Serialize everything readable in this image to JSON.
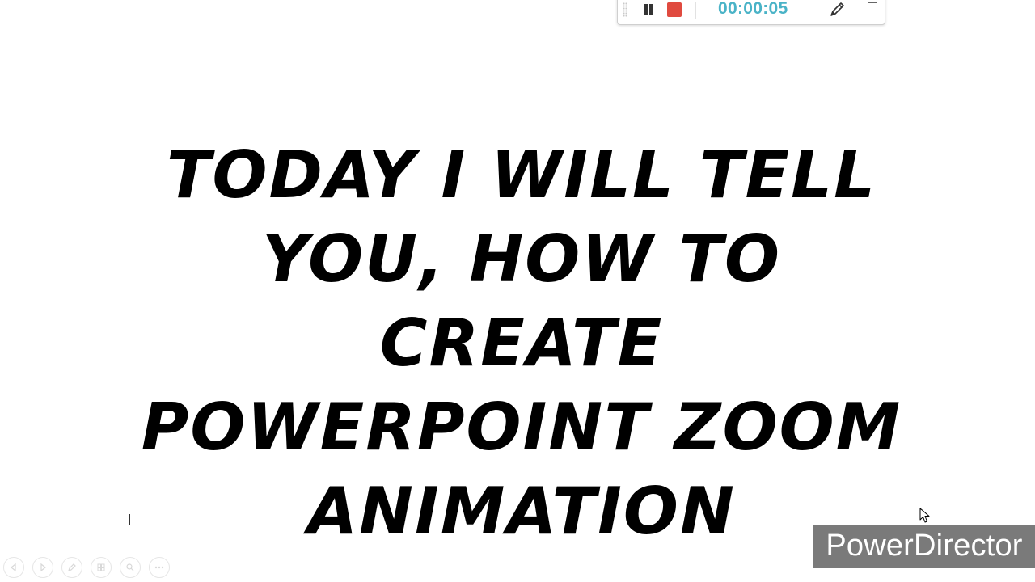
{
  "recorder_toolbar": {
    "timer": "00:00:05",
    "icons": [
      "drag-grip-icon",
      "pause-icon",
      "stop-icon",
      "pen-icon",
      "minimize-icon"
    ],
    "colors": {
      "timer": "#4ab3c7",
      "stop": "#e04a3f"
    }
  },
  "slide": {
    "title_lines": [
      "TODAY I WILL TELL",
      "YOU, HOW TO CREATE",
      "POWERPOINT ZOOM",
      "ANIMATION"
    ]
  },
  "slideshow_controls": {
    "icons": [
      "previous-icon",
      "next-icon",
      "pen-tool-icon",
      "see-all-slides-icon",
      "zoom-icon",
      "more-options-icon"
    ]
  },
  "watermark": {
    "text": "PowerDirector"
  }
}
